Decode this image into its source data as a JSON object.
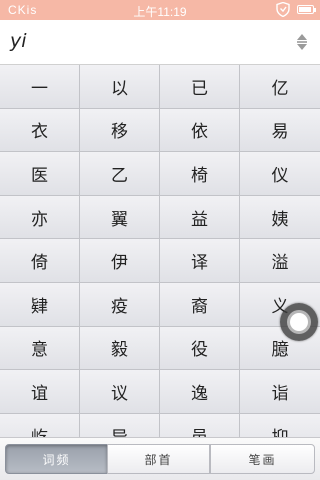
{
  "status_bar": {
    "carrier": "CKis",
    "time": "上午11:19",
    "battery_level": 0.9,
    "icons": [
      "shield-icon",
      "battery-icon"
    ]
  },
  "pinyin_bar": {
    "query": "yi",
    "sort_icon": "sort-arrows-icon"
  },
  "characters": [
    "一",
    "以",
    "已",
    "亿",
    "衣",
    "移",
    "依",
    "易",
    "医",
    "乙",
    "椅",
    "仪",
    "亦",
    "翼",
    "益",
    "姨",
    "倚",
    "伊",
    "译",
    "溢",
    "肄",
    "疫",
    "裔",
    "义",
    "意",
    "毅",
    "役",
    "臆",
    "谊",
    "议",
    "逸",
    "诣",
    "屹",
    "异",
    "邑",
    "抑"
  ],
  "tabs": [
    {
      "label": "词频",
      "active": true
    },
    {
      "label": "部首",
      "active": false
    },
    {
      "label": "笔画",
      "active": false
    }
  ],
  "colors": {
    "status_bar": "#f6b8a6",
    "grid_bg": "#e6e7eb",
    "active_tab": "#a4a9b3"
  }
}
